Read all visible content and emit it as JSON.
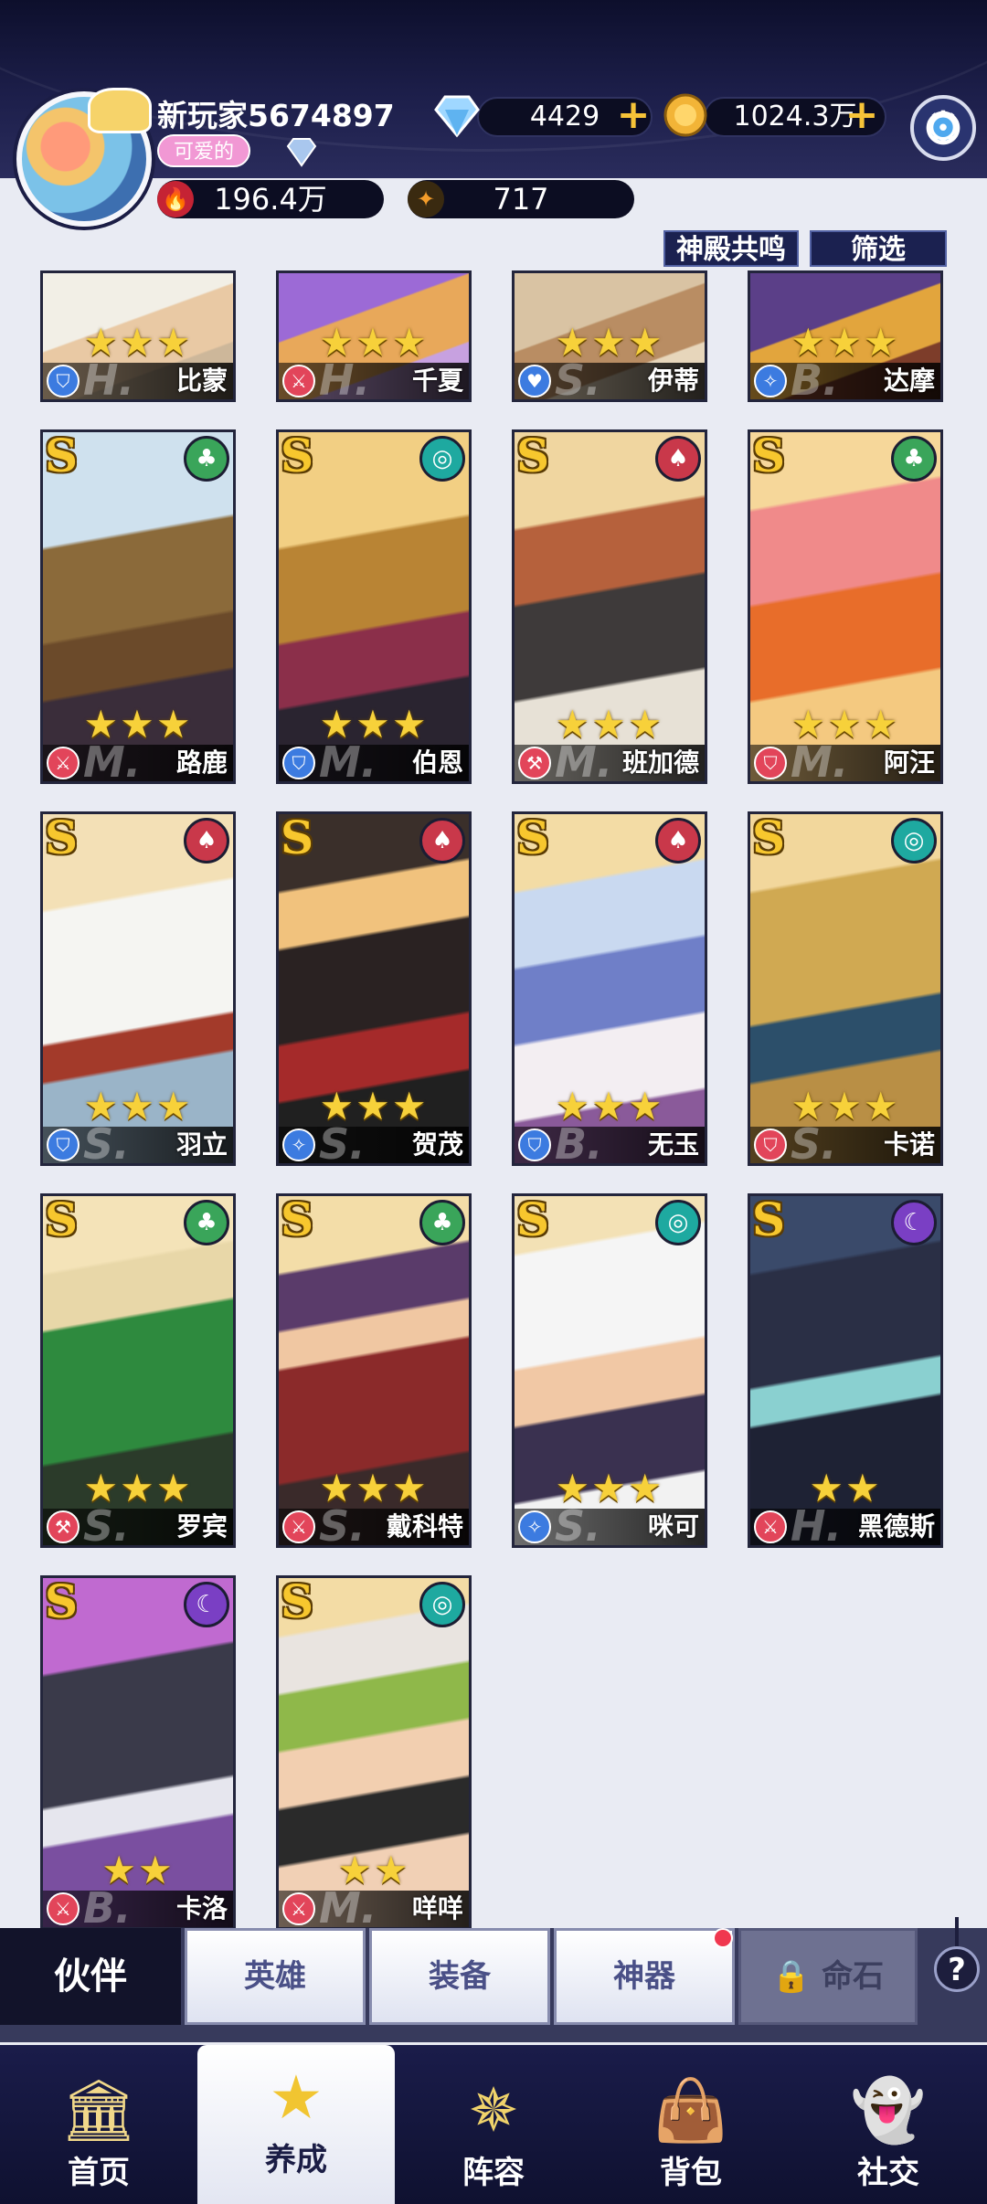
{
  "player": {
    "name": "新玩家5674897",
    "tag": "可爱的",
    "diamonds": "4429",
    "gold": "1024.3万",
    "power": "196.4万",
    "stars_resource": "717"
  },
  "filters": {
    "temple_label": "神殿共鸣",
    "filter_label": "筛选"
  },
  "partial_row": [
    {
      "name": "比蒙",
      "stars": "★★★"
    },
    {
      "name": "千夏",
      "stars": "★★★"
    },
    {
      "name": "伊蒂",
      "stars": "★★★"
    },
    {
      "name": "达摩",
      "stars": "★★★"
    }
  ],
  "heroes": [
    {
      "name": "路鹿",
      "rank": "S",
      "stars": "★★★",
      "grade": "M."
    },
    {
      "name": "伯恩",
      "rank": "S",
      "stars": "★★★",
      "grade": "M."
    },
    {
      "name": "班加德",
      "rank": "S",
      "stars": "★★★",
      "grade": "M."
    },
    {
      "name": "阿汪",
      "rank": "S",
      "stars": "★★★",
      "grade": "M."
    },
    {
      "name": "羽立",
      "rank": "S",
      "stars": "★★★",
      "grade": "S."
    },
    {
      "name": "贺茂",
      "rank": "S",
      "stars": "★★★",
      "grade": "S."
    },
    {
      "name": "无玉",
      "rank": "S",
      "stars": "★★★",
      "grade": "B."
    },
    {
      "name": "卡诺",
      "rank": "S",
      "stars": "★★★",
      "grade": "S."
    },
    {
      "name": "罗宾",
      "rank": "S",
      "stars": "★★★",
      "grade": "S."
    },
    {
      "name": "戴科特",
      "rank": "S",
      "stars": "★★★",
      "grade": "S."
    },
    {
      "name": "咪可",
      "rank": "S",
      "stars": "★★★",
      "grade": "S."
    },
    {
      "name": "黑德斯",
      "rank": "S",
      "stars": "★★",
      "grade": "H."
    },
    {
      "name": "卡洛",
      "rank": "S",
      "stars": "★★",
      "grade": "B."
    },
    {
      "name": "咩咩",
      "rank": "S",
      "stars": "★★",
      "grade": "M."
    }
  ],
  "subtabs": {
    "partner": "伙伴",
    "hero": "英雄",
    "equipment": "装备",
    "artifact": "神器",
    "fate_stone": "命石",
    "help": "?"
  },
  "nav": {
    "home": "首页",
    "develop": "养成",
    "lineup": "阵容",
    "bag": "背包",
    "social": "社交"
  },
  "colors": {
    "element_green": "#3aa55a",
    "element_teal": "#1ea9a0",
    "element_red": "#c9384a",
    "element_purple": "#7a3fc4",
    "role_red": "#e2455a",
    "role_blue": "#3c7be0"
  }
}
